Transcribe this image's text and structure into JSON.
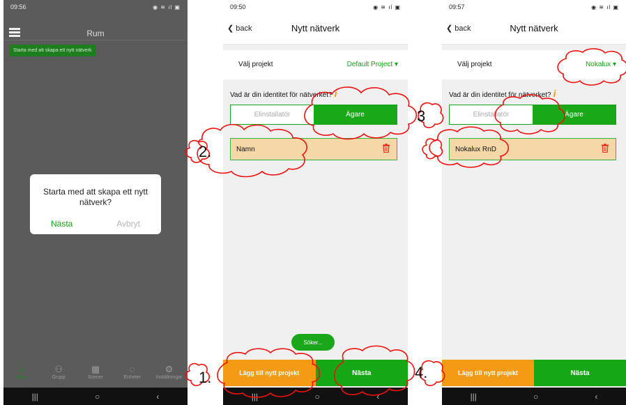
{
  "phone1": {
    "status_time": "09:56",
    "status_icons": "◉ ≋ ıl ▣",
    "menu_icon": "menu-icon",
    "title": "Rum",
    "tooltip": "Starta med att skapa ett nytt nätverk",
    "dialog": {
      "message": "Starta med att skapa ett nytt nätverk?",
      "next_label": "Nästa",
      "cancel_label": "Avbryt"
    },
    "nav": [
      {
        "label": "Rum",
        "icon": "home-icon",
        "glyph": "⌂"
      },
      {
        "label": "Grupp",
        "icon": "group-icon",
        "glyph": "⚇"
      },
      {
        "label": "Scener",
        "icon": "scene-icon",
        "glyph": "▦"
      },
      {
        "label": "Enheter",
        "icon": "bulb-icon",
        "glyph": "◌"
      },
      {
        "label": "Inställningar",
        "icon": "settings-icon",
        "glyph": "⚙"
      }
    ],
    "sysnav": [
      "|||",
      "○",
      "‹"
    ]
  },
  "phone2": {
    "status_time": "09:50",
    "status_icons": "◉ ≋ ıl ▣",
    "back_label": "back",
    "title": "Nytt nätverk",
    "project_label": "Välj projekt",
    "project_value": "Default Project",
    "identity_question": "Vad är din identitet för nätverket?",
    "seg_installer": "Elinstallatör",
    "seg_owner": "Ägare",
    "name_value": "Namn",
    "searching_label": "Söker...",
    "add_project_label": "Lägg till nytt projekt",
    "next_label": "Nästa",
    "sysnav": [
      "|||",
      "○",
      "‹"
    ]
  },
  "phone3": {
    "status_time": "09:57",
    "status_icons": "◉ ≋ ıl ▣",
    "back_label": "back",
    "title": "Nytt nätverk",
    "project_label": "Välj projekt",
    "project_value": "Nokalux",
    "identity_question": "Vad är din identitet för nätverket?",
    "seg_installer": "Elinstallatör",
    "seg_owner": "Ägare",
    "name_value": "Nokalux RnD",
    "add_project_label": "Lägg till nytt projekt",
    "next_label": "Nästa",
    "sysnav": [
      "|||",
      "○",
      "‹"
    ]
  },
  "annotations": [
    "1.",
    "2.",
    "3",
    "4."
  ],
  "colors": {
    "green": "#18a818",
    "orange": "#f49a14",
    "peach": "#f6d7a7",
    "dark_bg": "#5b5b5b"
  }
}
